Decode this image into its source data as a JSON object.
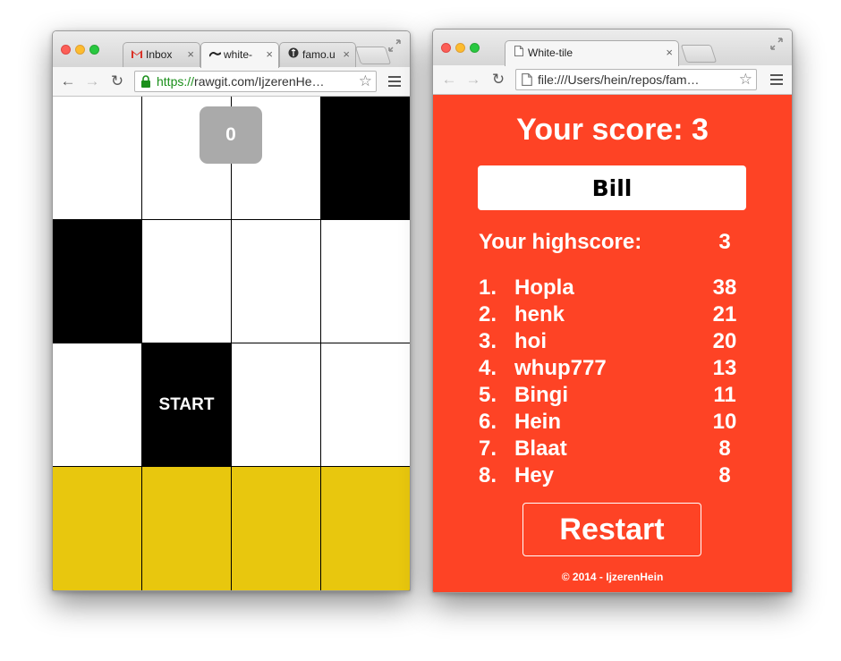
{
  "left_window": {
    "tabs": [
      {
        "icon": "gmail-icon",
        "label": "Inbox"
      },
      {
        "icon": "wave-icon",
        "label": "white-"
      },
      {
        "icon": "famous-icon",
        "label": "famo.u"
      }
    ],
    "active_tab": 1,
    "url": {
      "scheme": "https://",
      "rest": "rawgit.com/IjzerenHe…"
    },
    "game": {
      "score": "0",
      "start_label": "START",
      "rows": [
        [
          "white",
          "white",
          "white",
          "black"
        ],
        [
          "black",
          "white",
          "white",
          "white"
        ],
        [
          "white",
          "black",
          "white",
          "white"
        ],
        [
          "yellow",
          "yellow",
          "yellow",
          "yellow"
        ]
      ],
      "start_tile": {
        "row": 2,
        "col": 1
      }
    }
  },
  "right_window": {
    "tab": {
      "icon": "page-icon",
      "label": "White-tile"
    },
    "url": "file:///Users/hein/repos/fam…",
    "results": {
      "score_title": "Your score: 3",
      "name_value": "Bill",
      "highscore_label": "Your highscore:",
      "highscore_value": "3",
      "leaderboard": [
        {
          "rank": "1.",
          "name": "Hopla",
          "score": "38"
        },
        {
          "rank": "2.",
          "name": "henk",
          "score": "21"
        },
        {
          "rank": "3.",
          "name": "hoi",
          "score": "20"
        },
        {
          "rank": "4.",
          "name": "whup777",
          "score": "13"
        },
        {
          "rank": "5.",
          "name": "Bingi",
          "score": "11"
        },
        {
          "rank": "6.",
          "name": "Hein",
          "score": "10"
        },
        {
          "rank": "7.",
          "name": "Blaat",
          "score": "8"
        },
        {
          "rank": "8.",
          "name": "Hey",
          "score": "8"
        }
      ],
      "restart_label": "Restart",
      "footer": "© 2014 - IjzerenHein"
    }
  },
  "colors": {
    "accent_red": "#fe4325",
    "tile_yellow": "#e8c70e",
    "score_badge": "#aaaaaa",
    "secure_green": "#1a8f1a"
  }
}
